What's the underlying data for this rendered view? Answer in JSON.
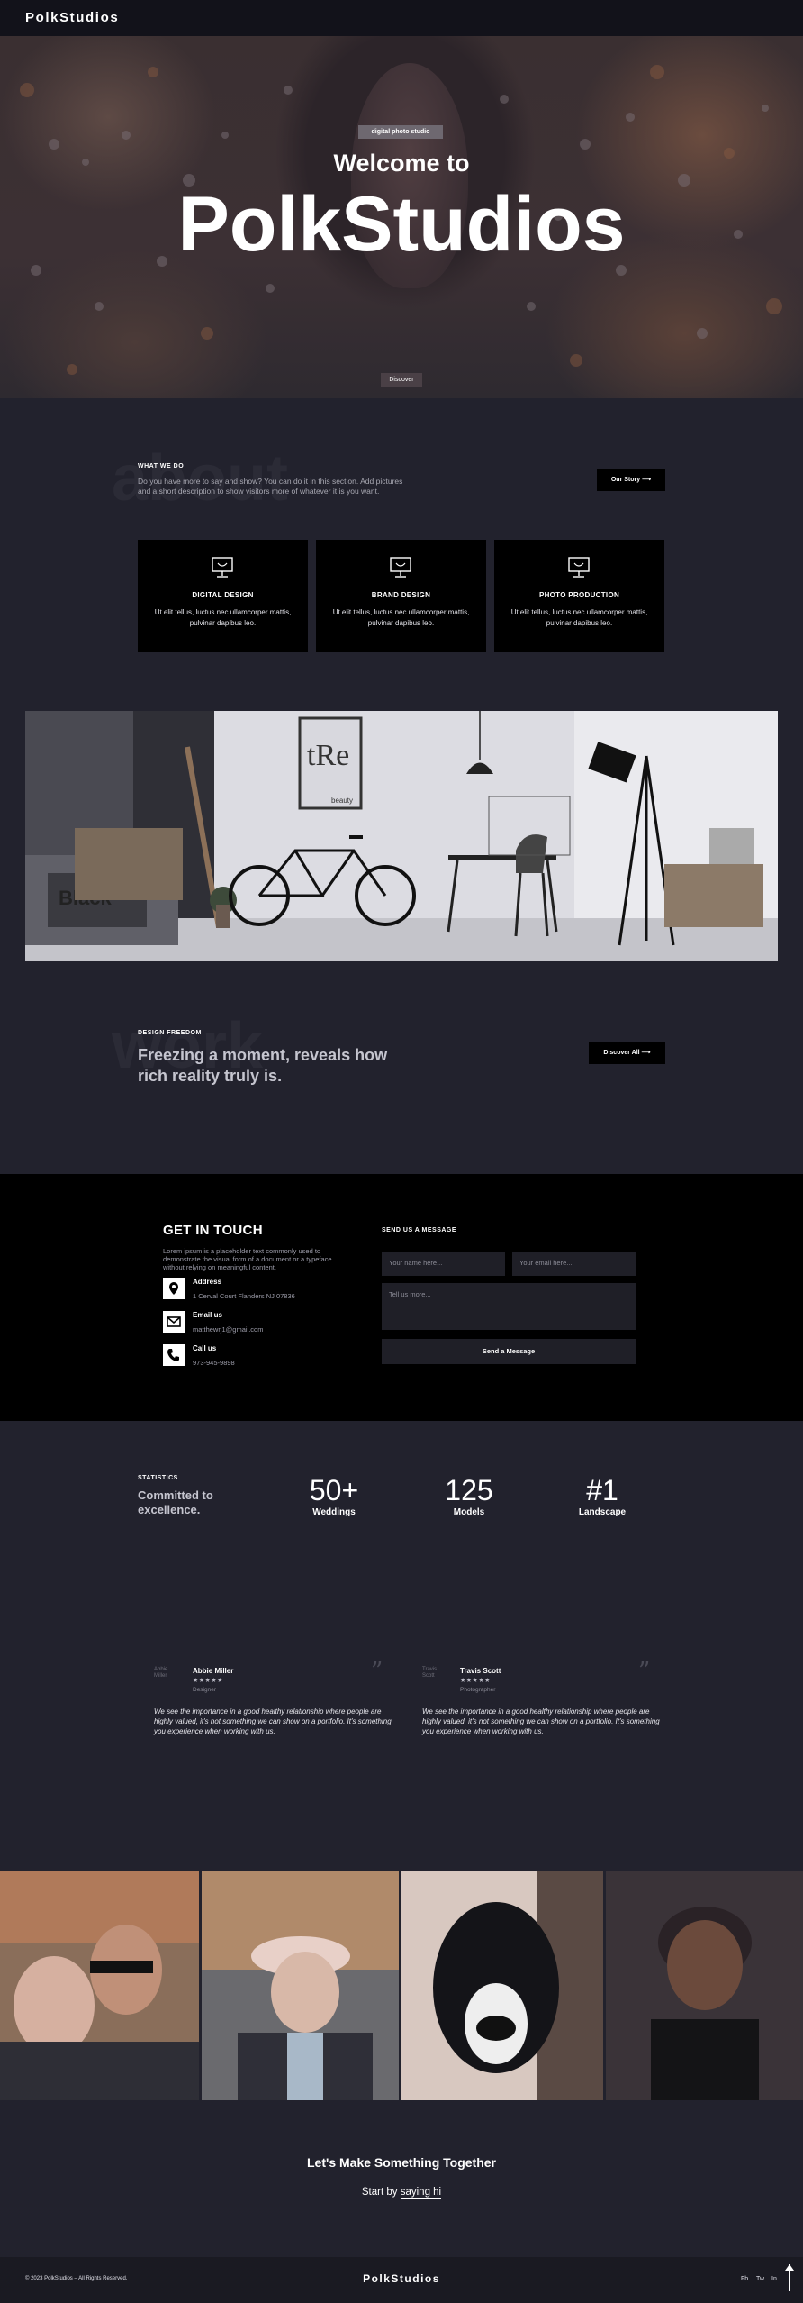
{
  "header": {
    "logo": "PolkStudios",
    "menu_icon": "menu-icon"
  },
  "hero": {
    "tag": "digital photo studio",
    "welcome": "Welcome to",
    "title": "PolkStudios",
    "discover": "Discover"
  },
  "what_we_do": {
    "ghost": "about",
    "label": "WHAT WE DO",
    "description": "Do you have more to say and show? You can do it in this section. Add pictures and a short description to show visitors more of whatever it is you want.",
    "button": "Our Story ⟶",
    "cards": [
      {
        "title": "DIGITAL DESIGN",
        "text": "Ut elit tellus, luctus nec ullamcorper mattis, pulvinar dapibus leo.",
        "icon": "monitor-icon"
      },
      {
        "title": "BRAND DESIGN",
        "text": "Ut elit tellus, luctus nec ullamcorper mattis, pulvinar dapibus leo.",
        "icon": "monitor-icon"
      },
      {
        "title": "PHOTO PRODUCTION",
        "text": "Ut elit tellus, luctus nec ullamcorper mattis, pulvinar dapibus leo.",
        "icon": "monitor-icon"
      }
    ]
  },
  "studio_photo": {
    "poster_text": "tRe",
    "poster_caption": "beauty",
    "cushion_text": "Black"
  },
  "design_freedom": {
    "ghost": "work",
    "label": "DESIGN FREEDOM",
    "heading": "Freezing a moment, reveals how rich reality truly is.",
    "button": "Discover All ⟶"
  },
  "contact": {
    "title": "GET IN TOUCH",
    "description": "Lorem ipsum is a placeholder text commonly used to demonstrate the visual form of a document or a typeface without relying on meaningful content.",
    "items": [
      {
        "label": "Address",
        "value": "1 Cerval Court Flanders NJ 07836",
        "icon": "location-pin-icon"
      },
      {
        "label": "Email us",
        "value": "matthewrj1@gmail.com",
        "icon": "mail-icon"
      },
      {
        "label": "Call us",
        "value": "973-945-9898",
        "icon": "phone-icon"
      }
    ],
    "form": {
      "label": "SEND US A MESSAGE",
      "name_placeholder": "Your name here...",
      "email_placeholder": "Your email here...",
      "message_placeholder": "Tell us more...",
      "submit": "Send a Message"
    }
  },
  "stats": {
    "label": "STATISTICS",
    "heading": "Committed to excellence.",
    "items": [
      {
        "number": "50+",
        "label": "Weddings"
      },
      {
        "number": "125",
        "label": "Models"
      },
      {
        "number": "#1",
        "label": "Landscape"
      }
    ]
  },
  "testimonials": [
    {
      "avatar_alt": "Abbie Miller",
      "name": "Abbie Miller",
      "stars": "★★★★★",
      "role": "Designer",
      "text": "We see the importance in a good healthy relationship where people are highly valued, it's not something we can show on a portfolio. It's something you experience when working with us."
    },
    {
      "avatar_alt": "Travis Scott",
      "name": "Travis Scott",
      "stars": "★★★★★",
      "role": "Photographer",
      "text": "We see the importance in a good healthy relationship where people are highly valued, it's not something we can show on a portfolio. It's something you experience when working with us."
    }
  ],
  "cta": {
    "heading": "Let's Make Something Together",
    "prefix": "Start by",
    "link": "saying hi"
  },
  "footer": {
    "copyright": "© 2023 PolkStudios – All Rights Reserved.",
    "logo": "PolkStudios",
    "social": [
      "Fb",
      "Tw",
      "In"
    ]
  }
}
